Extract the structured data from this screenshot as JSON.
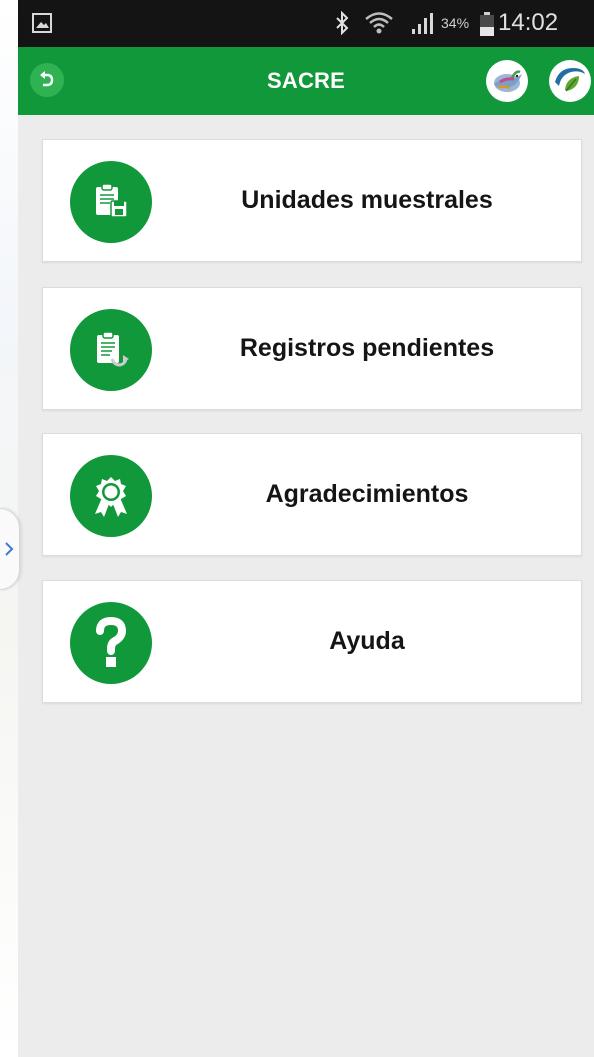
{
  "status_bar": {
    "battery_percent": "34%",
    "time": "14:02",
    "icons": [
      "gallery-icon",
      "bluetooth-icon",
      "wifi-icon",
      "signal-icon",
      "battery-icon"
    ]
  },
  "app_bar": {
    "title": "SACRE",
    "back_icon": "back-arrow-icon",
    "logos": [
      "bird-logo",
      "leaf-logo"
    ]
  },
  "menu": [
    {
      "label": "Unidades muestrales",
      "icon": "clipboard-save-icon"
    },
    {
      "label": "Registros pendientes",
      "icon": "clipboard-refresh-icon"
    },
    {
      "label": "Agradecimientos",
      "icon": "award-ribbon-icon"
    },
    {
      "label": "Ayuda",
      "icon": "question-mark-icon"
    }
  ],
  "colors": {
    "brand_green": "#11983a",
    "status_bar": "#141414",
    "background": "#ececec"
  }
}
